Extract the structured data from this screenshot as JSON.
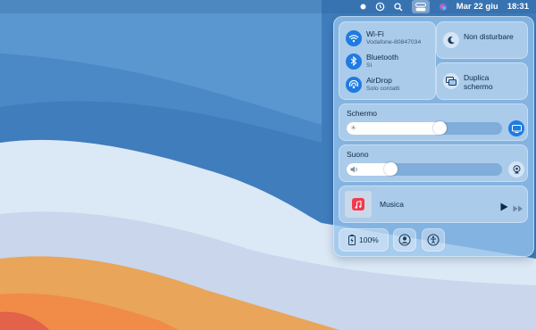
{
  "menubar": {
    "date": "Mar 22 giu",
    "time": "18:31",
    "icons": [
      "dot-icon",
      "time-machine-icon",
      "spotlight-search-icon",
      "control-center-icon",
      "siri-icon"
    ]
  },
  "connectivity": {
    "wifi": {
      "title": "Wi-Fi",
      "subtitle": "Vodafone-80847034",
      "icon": "wifi-icon"
    },
    "bluetooth": {
      "title": "Bluetooth",
      "subtitle": "Sì",
      "icon": "bluetooth-icon"
    },
    "airdrop": {
      "title": "AirDrop",
      "subtitle": "Solo contatti",
      "icon": "airdrop-icon"
    }
  },
  "focus": {
    "label": "Non disturbare",
    "icon": "moon-icon"
  },
  "screen_mirroring": {
    "label": "Duplica schermo",
    "icon": "screen-mirroring-icon"
  },
  "display": {
    "label": "Schermo",
    "level": 0.6
  },
  "sound": {
    "label": "Suono",
    "level": 0.28
  },
  "now_playing": {
    "label": "Musica"
  },
  "bottom": {
    "battery": "100%"
  },
  "colors": {
    "accent": "#1f7be0",
    "panel": "#9fc8ee",
    "desktop": "#3a78b8"
  }
}
